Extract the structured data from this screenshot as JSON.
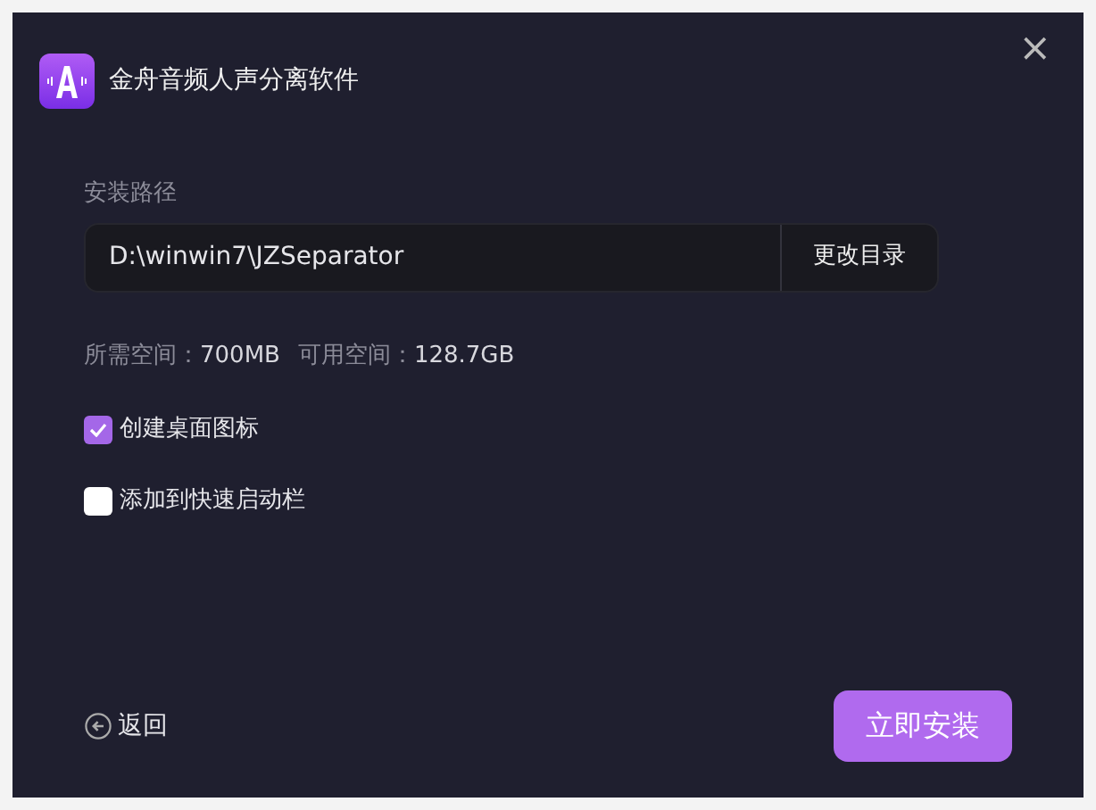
{
  "window": {
    "title": "金舟音频人声分离软件",
    "close": "×"
  },
  "install_path": {
    "label": "安装路径",
    "value": "D:\\winwin7\\JZSeparator",
    "button": "更改目录"
  },
  "space": [
    {
      "label": "所需空间：",
      "value": "700MB"
    },
    {
      "label": "可用空间：",
      "value": "128.7GB"
    }
  ],
  "options": [
    {
      "label": "创建桌面图标",
      "checked": true
    },
    {
      "label": "添加到快速启动栏",
      "checked": false
    }
  ],
  "back": "返回",
  "install_button": "立即安装"
}
